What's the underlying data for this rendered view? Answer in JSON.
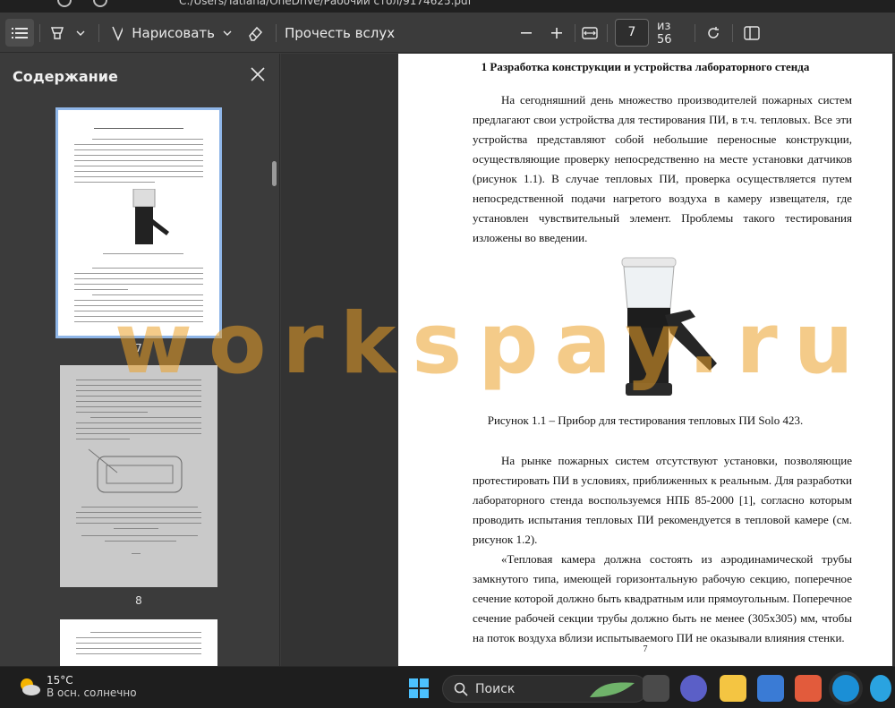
{
  "window": {
    "path": "C:/Users/Tatiana/OneDrive/Рабочий стол/9174625.pdf"
  },
  "toolbar": {
    "draw_label": "Нарисовать",
    "read_aloud_label": "Прочесть вслух",
    "page_current": "7",
    "page_total": "из 56"
  },
  "sidebar": {
    "title": "Содержание",
    "thumbnails": [
      {
        "number": "7"
      },
      {
        "number": "8"
      }
    ]
  },
  "document": {
    "heading": "1 Разработка конструкции и устройства лабораторного стенда",
    "para1": "На сегодняшний день множество производителей пожарных систем предлагают свои устройства для тестирования ПИ, в т.ч. тепловых. Все эти устройства представляют собой небольшие переносные конструкции, осуществляющие проверку непосредственно на месте установки датчиков (рисунок 1.1). В случае тепловых ПИ, проверка осуществляется путем непосредственной подачи нагретого воздуха в камеру извещателя, где установлен чувствительный элемент. Проблемы такого тестирования изложены во введении.",
    "figure_caption": "Рисунок 1.1 – Прибор для тестирования тепловых ПИ Solo 423.",
    "para2": "На рынке пожарных систем отсутствуют установки, позволяющие протестировать ПИ в условиях, приближенных к реальным. Для разработки лабораторного стенда воспользуемся НПБ 85-2000 [1], согласно которым проводить испытания тепловых ПИ рекомендуется в тепловой камере (см. рисунок 1.2).",
    "para3": "«Тепловая камера должна состоять из аэродинамической трубы замкнутого типа, имеющей горизонтальную рабочую секцию, поперечное сечение которой должно быть квадратным или прямоугольным. Поперечное сечение рабочей секции трубы должно быть не менее (305х305) мм, чтобы на поток воздуха вблизи испытываемого ПИ не оказывали влияния стенки.",
    "page_number": "7"
  },
  "watermark": "workspay.ru",
  "taskbar": {
    "temperature": "15°C",
    "weather": "В осн. солнечно",
    "search_label": "Поиск"
  }
}
